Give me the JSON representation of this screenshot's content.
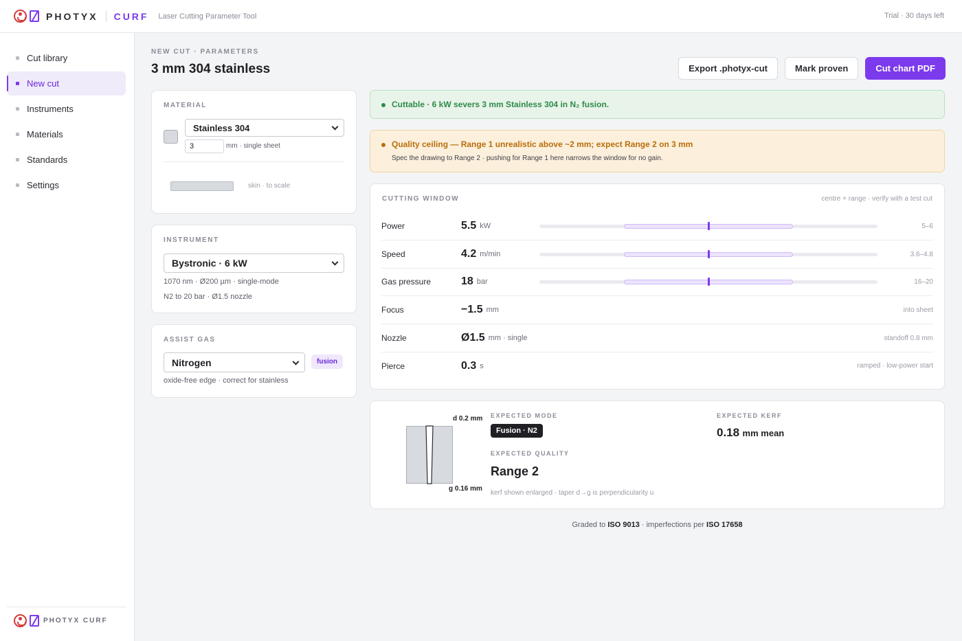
{
  "app": {
    "brand_left": "PHOTYX",
    "brand_right": "CURF",
    "subtitle": "Laser Cutting Parameter Tool",
    "trial": "Trial · 30 days left",
    "footer_brand": "PHOTYX CURF"
  },
  "nav": [
    {
      "label": "Cut library",
      "active": false
    },
    {
      "label": "New cut",
      "active": true
    },
    {
      "label": "Instruments",
      "active": false
    },
    {
      "label": "Materials",
      "active": false
    },
    {
      "label": "Standards",
      "active": false
    },
    {
      "label": "Settings",
      "active": false
    }
  ],
  "header": {
    "breadcrumb": "NEW CUT · PARAMETERS",
    "title": "3 mm 304 stainless",
    "export_label": "Export .photyx-cut",
    "proven_label": "Mark proven",
    "pdf_label": "Cut chart PDF"
  },
  "material": {
    "label": "MATERIAL",
    "selected": "Stainless 304",
    "thickness": "3",
    "thickness_unit": "mm · single sheet",
    "skin_note": "skin · to scale"
  },
  "instrument": {
    "label": "INSTRUMENT",
    "selected": "Bystronic · 6 kW",
    "spec1": "1070 nm · Ø200 µm · single-mode",
    "spec2": "N2 to 20 bar · Ø1.5 nozzle"
  },
  "gas": {
    "label": "ASSIST GAS",
    "selected": "Nitrogen",
    "tag": "fusion",
    "note": "oxide-free edge · correct for stainless"
  },
  "alerts": {
    "ok": "Cuttable · 6 kW severs 3 mm Stainless 304 in N₂ fusion.",
    "warn_title": "Quality ceiling — Range 1 unrealistic above ~2 mm; expect Range 2 on 3 mm",
    "warn_sub": "Spec the drawing to Range 2 · pushing for Range 1 here narrows the window for no gain."
  },
  "window": {
    "label": "CUTTING WINDOW",
    "hint": "centre + range · verify with a test cut",
    "rows": [
      {
        "name": "Power",
        "value": "5.5",
        "unit": "kW",
        "note": "5–6",
        "bar": {
          "lo": 0.25,
          "hi": 0.75,
          "mid": 0.5
        }
      },
      {
        "name": "Speed",
        "value": "4.2",
        "unit": "m/min",
        "note": "3.6–4.8",
        "bar": {
          "lo": 0.25,
          "hi": 0.75,
          "mid": 0.5
        }
      },
      {
        "name": "Gas pressure",
        "value": "18",
        "unit": "bar",
        "note": "16–20",
        "bar": {
          "lo": 0.25,
          "hi": 0.75,
          "mid": 0.5
        }
      },
      {
        "name": "Focus",
        "value": "−1.5",
        "unit": "mm",
        "note": "into sheet"
      },
      {
        "name": "Nozzle",
        "value": "Ø1.5",
        "unit": "mm · single",
        "note": "standoff 0.8 mm"
      },
      {
        "name": "Pierce",
        "value": "0.3",
        "unit": "s",
        "note": "ramped · low-power start"
      }
    ]
  },
  "expected": {
    "top_label": "d 0.2 mm",
    "bottom_label": "g 0.16 mm",
    "mode_label": "EXPECTED MODE",
    "mode": "Fusion · N2",
    "quality_label": "EXPECTED QUALITY",
    "quality": "Range 2",
    "kerf_label": "EXPECTED KERF",
    "kerf_value": "0.18",
    "kerf_unit": "mm mean",
    "caption": "kerf shown enlarged · taper d→g is perpendicularity u"
  },
  "footer": {
    "pre": "Graded to",
    "std1": "ISO 9013",
    "mid": "· imperfections per",
    "std2": "ISO 17658"
  },
  "colors": {
    "accent": "#7c3aed",
    "ok": "#2e8b48",
    "warn": "#b86e0b",
    "logo_red": "#d63a3a"
  }
}
